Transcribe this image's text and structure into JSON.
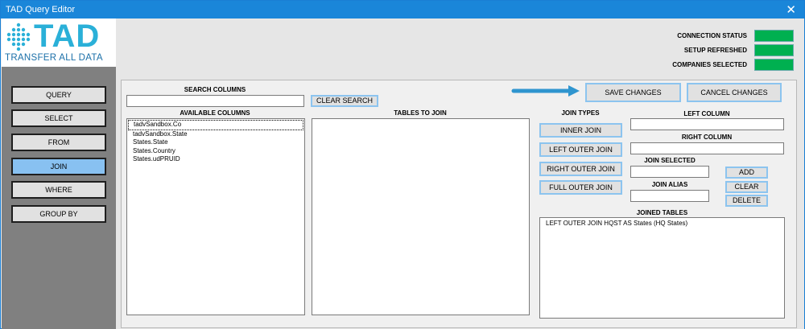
{
  "window": {
    "title": "TAD Query Editor",
    "close_symbol": "✕"
  },
  "logo": {
    "text": "TAD",
    "tagline": "TRANSFER ALL DATA",
    "accent": "#2ab0d8"
  },
  "sidebar": {
    "items": [
      {
        "label": "QUERY"
      },
      {
        "label": "SELECT"
      },
      {
        "label": "FROM"
      },
      {
        "label": "JOIN",
        "active": true
      },
      {
        "label": "WHERE"
      },
      {
        "label": "GROUP BY"
      }
    ]
  },
  "status": {
    "connection": "CONNECTION STATUS",
    "setup": "SETUP REFRESHED",
    "companies": "COMPANIES SELECTED",
    "color": "#00b050"
  },
  "search": {
    "label": "SEARCH COLUMNS",
    "value": "",
    "clear_label": "CLEAR SEARCH"
  },
  "available": {
    "label": "AVAILABLE COLUMNS",
    "items": [
      "tadvSandbox.Co",
      "tadvSandbox.State",
      "States.State",
      "States.Country",
      "States.udPRUID"
    ]
  },
  "tables_to_join": {
    "label": "TABLES TO JOIN"
  },
  "actions": {
    "save": "SAVE CHANGES",
    "cancel": "CANCEL CHANGES"
  },
  "join_types": {
    "label": "JOIN TYPES",
    "inner": "INNER JOIN",
    "left_outer": "LEFT OUTER JOIN",
    "right_outer": "RIGHT OUTER JOIN",
    "full_outer": "FULL OUTER JOIN"
  },
  "fields": {
    "left_column": "LEFT COLUMN",
    "right_column": "RIGHT COLUMN",
    "join_selected": "JOIN SELECTED",
    "join_alias": "JOIN ALIAS"
  },
  "side_buttons": {
    "add": "ADD",
    "clear": "CLEAR",
    "delete": "DELETE"
  },
  "joined_tables": {
    "label": "JOINED TABLES",
    "items": [
      "LEFT OUTER JOIN HQST AS States (HQ States)"
    ]
  }
}
